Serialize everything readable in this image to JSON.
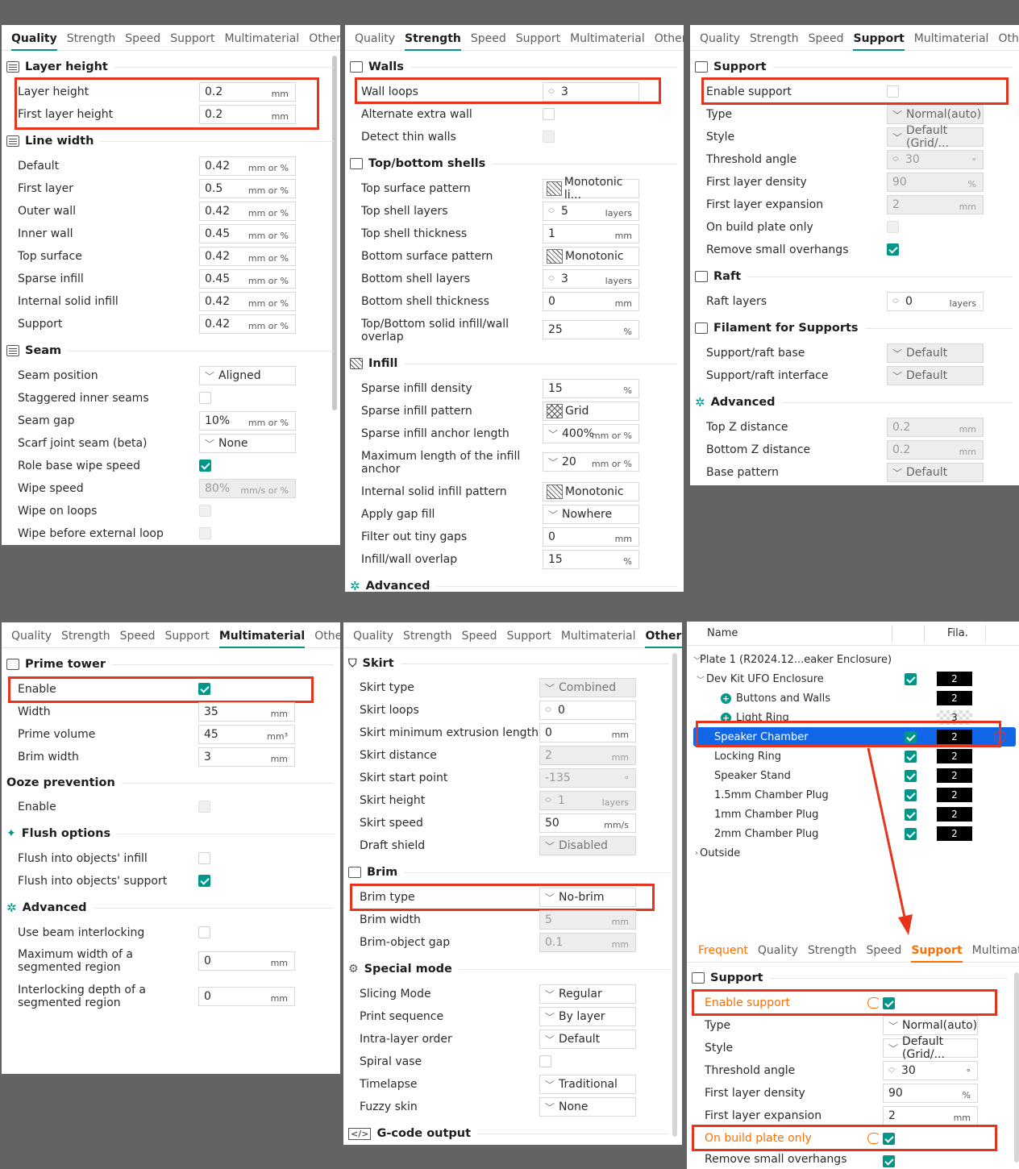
{
  "tabs": {
    "frequent": "Frequent",
    "quality": "Quality",
    "strength": "Strength",
    "speed": "Speed",
    "support": "Support",
    "multimaterial": "Multimaterial",
    "others": "Others"
  },
  "p1": {
    "s_layer": "Layer height",
    "layer_height": "Layer height",
    "layer_height_v": "0.2",
    "first_layer_height": "First layer height",
    "first_layer_height_v": "0.2",
    "mm": "mm",
    "s_line": "Line width",
    "u_mmp": "mm or %",
    "lw": [
      {
        "l": "Default",
        "v": "0.42"
      },
      {
        "l": "First layer",
        "v": "0.5"
      },
      {
        "l": "Outer wall",
        "v": "0.42"
      },
      {
        "l": "Inner wall",
        "v": "0.45"
      },
      {
        "l": "Top surface",
        "v": "0.42"
      },
      {
        "l": "Sparse infill",
        "v": "0.45"
      },
      {
        "l": "Internal solid infill",
        "v": "0.42"
      },
      {
        "l": "Support",
        "v": "0.42"
      }
    ],
    "s_seam": "Seam",
    "seam_position": "Seam position",
    "seam_position_v": "Aligned",
    "staggered": "Staggered inner seams",
    "seam_gap": "Seam gap",
    "seam_gap_v": "10%",
    "scarf": "Scarf joint seam (beta)",
    "scarf_v": "None",
    "role_wipe": "Role base wipe speed",
    "wipe_speed": "Wipe speed",
    "wipe_speed_v": "80%",
    "wipe_speed_u": "mm/s or %",
    "wipe_loops": "Wipe on loops",
    "wipe_before": "Wipe before external loop"
  },
  "p2": {
    "s_walls": "Walls",
    "wall_loops": "Wall loops",
    "wall_loops_v": "3",
    "alt_wall": "Alternate extra wall",
    "detect_thin": "Detect thin walls",
    "s_shells": "Top/bottom shells",
    "top_pattern": "Top surface pattern",
    "top_pattern_v": "Monotonic li...",
    "top_layers": "Top shell layers",
    "top_layers_v": "5",
    "layers": "layers",
    "top_thick": "Top shell thickness",
    "top_thick_v": "1",
    "mm": "mm",
    "bot_pattern": "Bottom surface pattern",
    "bot_pattern_v": "Monotonic",
    "bot_layers": "Bottom shell layers",
    "bot_layers_v": "3",
    "bot_thick": "Bottom shell thickness",
    "bot_thick_v": "0",
    "tb_overlap": "Top/Bottom solid infill/wall overlap",
    "tb_overlap_v": "25",
    "pct": "%",
    "s_infill": "Infill",
    "density": "Sparse infill density",
    "density_v": "15",
    "inf_pattern": "Sparse infill pattern",
    "inf_pattern_v": "Grid",
    "anchor": "Sparse infill anchor length",
    "anchor_v": "400%",
    "mmp": "mm or %",
    "max_anchor": "Maximum length of the infill anchor",
    "max_anchor_v": "20",
    "int_pattern": "Internal solid infill pattern",
    "int_pattern_v": "Monotonic",
    "gap_fill": "Apply gap fill",
    "gap_fill_v": "Nowhere",
    "filter_gaps": "Filter out tiny gaps",
    "filter_gaps_v": "0",
    "iw_overlap": "Infill/wall overlap",
    "iw_overlap_v": "15",
    "s_adv": "Advanced"
  },
  "p3": {
    "s_support": "Support",
    "enable": "Enable support",
    "type": "Type",
    "type_v": "Normal(auto)",
    "style": "Style",
    "style_v": "Default (Grid/...",
    "threshold": "Threshold angle",
    "threshold_v": "30",
    "deg": "°",
    "fl_density": "First layer density",
    "fl_density_v": "90",
    "pct": "%",
    "fl_exp": "First layer expansion",
    "fl_exp_v": "2",
    "mm": "mm",
    "build_plate": "On build plate only",
    "remove_small": "Remove small overhangs",
    "s_raft": "Raft",
    "raft_layers": "Raft layers",
    "raft_layers_v": "0",
    "layers": "layers",
    "s_fil": "Filament for Supports",
    "base": "Support/raft base",
    "base_v": "Default",
    "iface": "Support/raft interface",
    "iface_v": "Default",
    "s_adv": "Advanced",
    "top_z": "Top Z distance",
    "top_z_v": "0.2",
    "bot_z": "Bottom Z distance",
    "bot_z_v": "0.2",
    "base_pattern": "Base pattern",
    "base_pattern_v": "Default"
  },
  "p4": {
    "s_prime": "Prime tower",
    "enable": "Enable",
    "width": "Width",
    "width_v": "35",
    "mm": "mm",
    "prime_vol": "Prime volume",
    "prime_vol_v": "45",
    "mm3": "mm³",
    "brim_w": "Brim width",
    "brim_w_v": "3",
    "s_ooze": "Ooze prevention",
    "ooze_enable": "Enable",
    "s_flush": "Flush options",
    "flush_infill": "Flush into objects' infill",
    "flush_support": "Flush into objects' support",
    "s_adv": "Advanced",
    "beam": "Use beam interlocking",
    "max_width": "Maximum width of a segmented region",
    "max_width_v": "0",
    "depth": "Interlocking depth of a segmented region",
    "depth_v": "0"
  },
  "p5": {
    "s_skirt": "Skirt",
    "skirt_type": "Skirt type",
    "skirt_type_v": "Combined",
    "skirt_loops": "Skirt loops",
    "skirt_loops_v": "0",
    "skirt_min": "Skirt minimum extrusion length",
    "skirt_min_v": "0",
    "mm": "mm",
    "skirt_dist": "Skirt distance",
    "skirt_dist_v": "2",
    "skirt_start": "Skirt start point",
    "skirt_start_v": "-135",
    "deg": "°",
    "skirt_height": "Skirt height",
    "skirt_height_v": "1",
    "layers": "layers",
    "skirt_speed": "Skirt speed",
    "skirt_speed_v": "50",
    "mms": "mm/s",
    "draft": "Draft shield",
    "draft_v": "Disabled",
    "s_brim": "Brim",
    "brim_type": "Brim type",
    "brim_type_v": "No-brim",
    "brim_width": "Brim width",
    "brim_width_v": "5",
    "brim_gap": "Brim-object gap",
    "brim_gap_v": "0.1",
    "s_special": "Special mode",
    "slicing": "Slicing Mode",
    "slicing_v": "Regular",
    "sequence": "Print sequence",
    "sequence_v": "By layer",
    "intra": "Intra-layer order",
    "intra_v": "Default",
    "spiral": "Spiral vase",
    "timelapse": "Timelapse",
    "timelapse_v": "Traditional",
    "fuzzy": "Fuzzy skin",
    "fuzzy_v": "None",
    "s_gcode": "G-code output"
  },
  "p6": {
    "col_name": "Name",
    "col_fila": "Fila.",
    "plate": "Plate 1 (R2024.12...eaker Enclosure)",
    "dev": "Dev Kit UFO Enclosure",
    "buttons": "Buttons and Walls",
    "light": "Light Ring",
    "speaker": "Speaker Chamber",
    "locking": "Locking Ring",
    "stand": "Speaker Stand",
    "plug15": "1.5mm Chamber Plug",
    "plug1": "1mm Chamber Plug",
    "plug2": "2mm Chamber Plug",
    "outside": "Outside",
    "f2": "2",
    "f3": "3",
    "s_support": "Support",
    "enable": "Enable support",
    "type": "Type",
    "type_v": "Normal(auto)",
    "style": "Style",
    "style_v": "Default (Grid/...",
    "threshold": "Threshold angle",
    "threshold_v": "30",
    "deg": "°",
    "fl_density": "First layer density",
    "fl_density_v": "90",
    "pct": "%",
    "fl_exp": "First layer expansion",
    "fl_exp_v": "2",
    "mm": "mm",
    "build_plate": "On build plate only",
    "remove_small": "Remove small overhangs"
  },
  "colors": {
    "accent": "#009688",
    "highlight": "#e8341c",
    "orange": "#ff6f00",
    "selection": "#1167e8"
  }
}
